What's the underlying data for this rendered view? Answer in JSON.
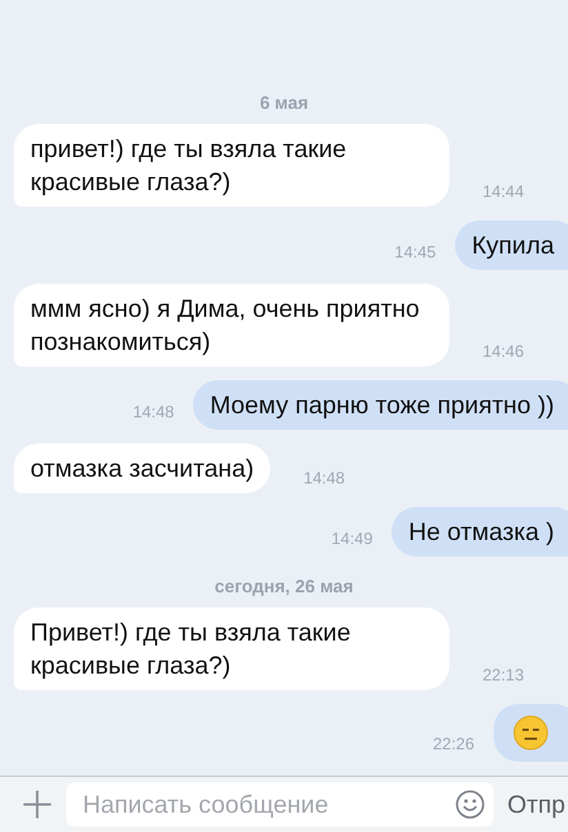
{
  "messages": [
    {
      "kind": "date",
      "text": "6 мая"
    },
    {
      "kind": "in",
      "text": "привет!) где ты взяла такие красивые глаза?)",
      "time": "14:44"
    },
    {
      "kind": "out",
      "text": "Купила",
      "time": "14:45"
    },
    {
      "kind": "in",
      "text": "ммм ясно) я Дима, очень приятно познакомиться)",
      "time": "14:46"
    },
    {
      "kind": "out",
      "text": "Моему парню тоже приятно ))",
      "time": "14:48"
    },
    {
      "kind": "in",
      "text": "отмазка засчитана)",
      "time": "14:48"
    },
    {
      "kind": "out",
      "text": "Не отмазка )",
      "time": "14:49"
    },
    {
      "kind": "date",
      "text": "сегодня, 26 мая"
    },
    {
      "kind": "in",
      "text": "Привет!) где ты взяла такие красивые глаза?)",
      "time": "22:13"
    },
    {
      "kind": "out_emoji",
      "time": "22:26"
    }
  ],
  "composer": {
    "placeholder": "Написать сообщение",
    "send": "Отпр"
  }
}
